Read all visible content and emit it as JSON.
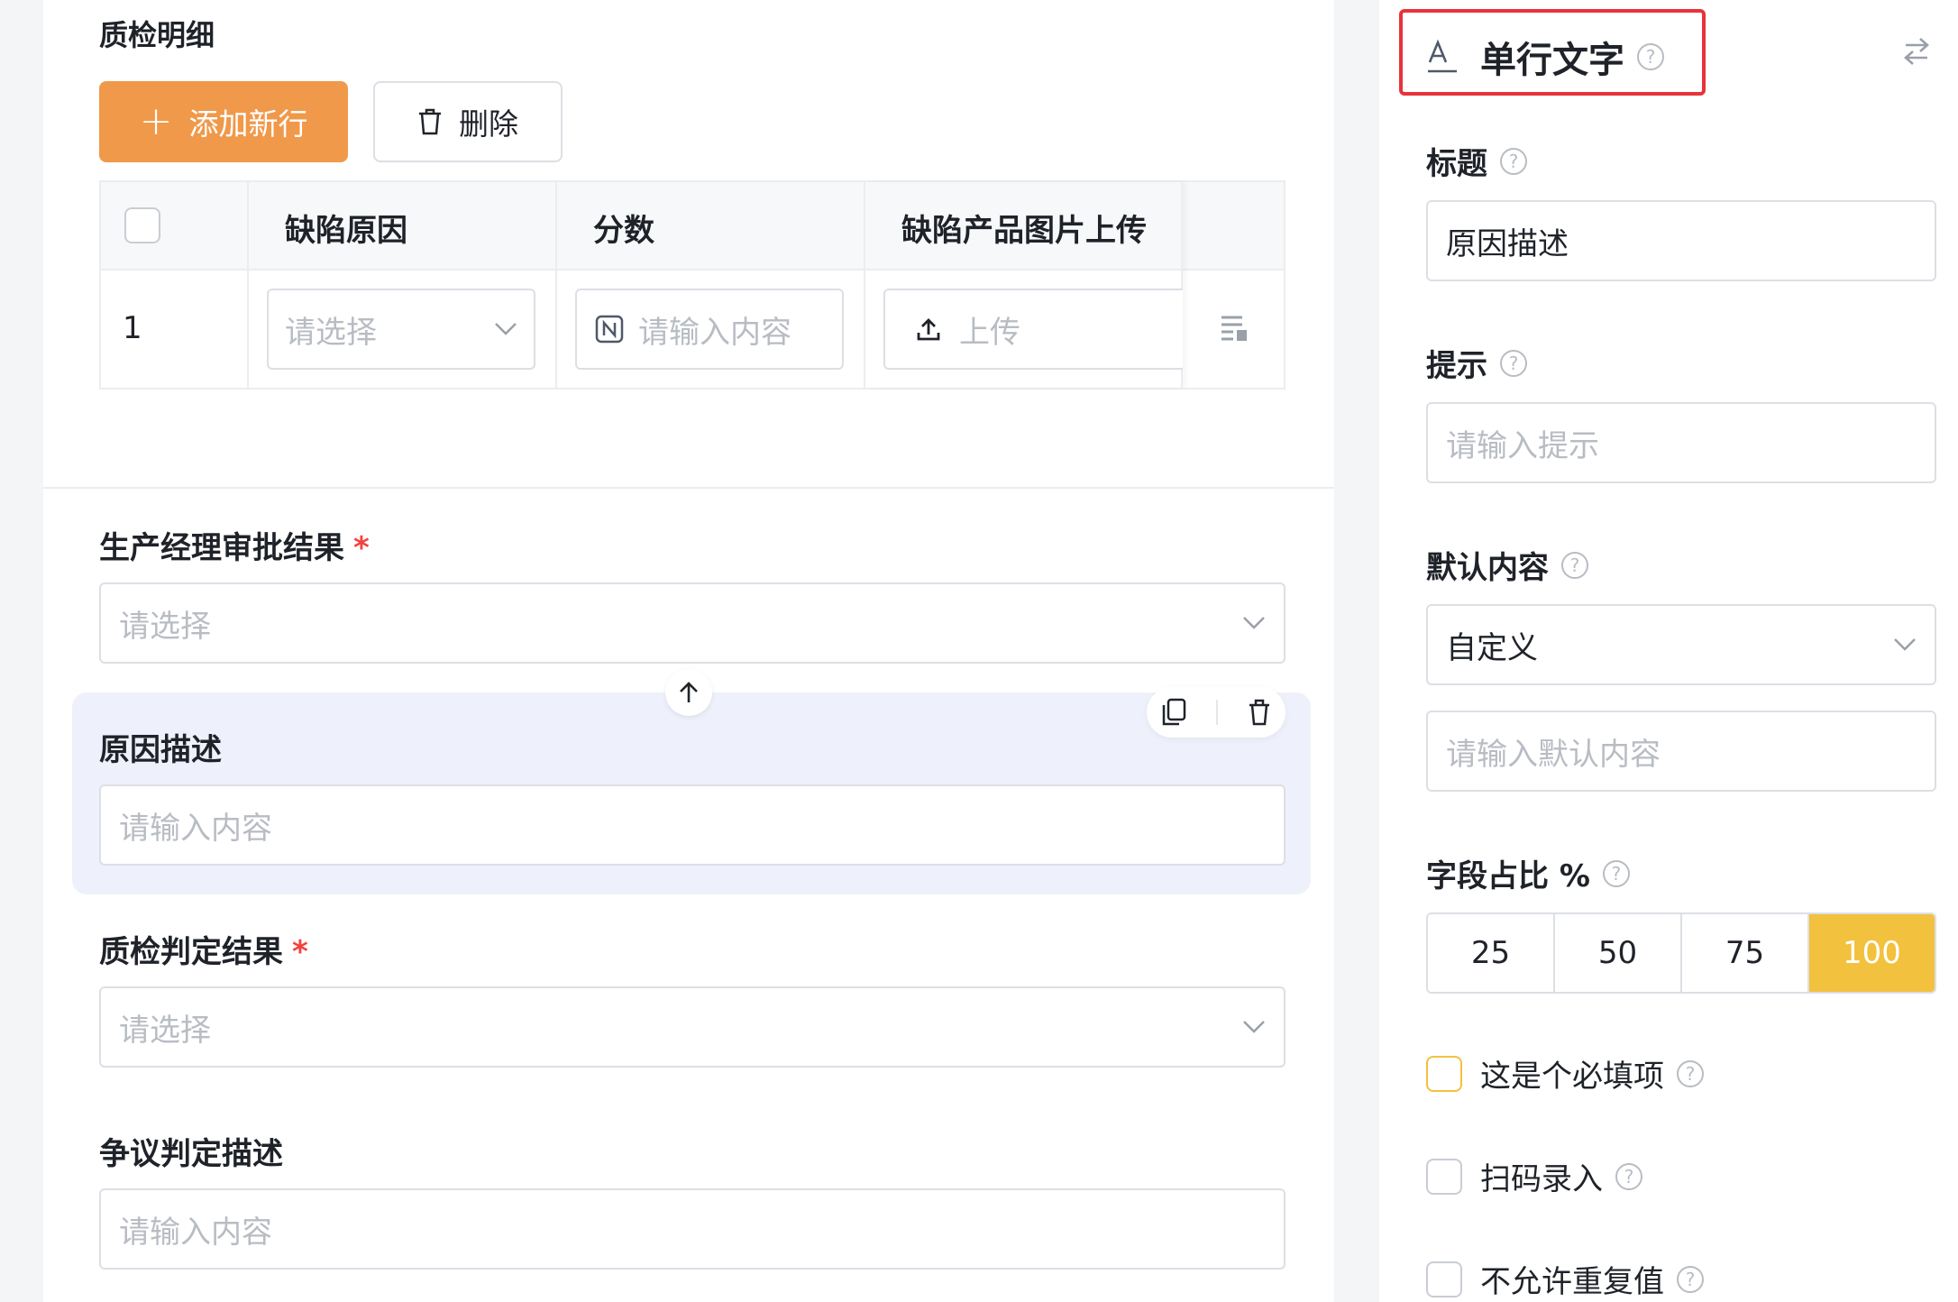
{
  "detail": {
    "title": "质检明细",
    "add_row_label": "添加新行",
    "delete_label": "删除",
    "columns": [
      "缺陷原因",
      "分数",
      "缺陷产品图片上传"
    ],
    "row_index": "1",
    "select_placeholder": "请选择",
    "input_placeholder": "请输入内容",
    "upload_label": "上传"
  },
  "fields": [
    {
      "label": "生产经理审批结果",
      "required": "*",
      "placeholder": "请选择"
    },
    {
      "label": "原因描述",
      "placeholder": "请输入内容"
    },
    {
      "label": "质检判定结果",
      "required": "*",
      "placeholder": "请选择"
    },
    {
      "label": "争议判定描述",
      "placeholder": "请输入内容"
    }
  ],
  "panel": {
    "title": "单行文字",
    "help": "?",
    "title_label": "标题",
    "title_value": "原因描述",
    "hint_label": "提示",
    "hint_placeholder": "请输入提示",
    "default_label": "默认内容",
    "default_mode": "自定义",
    "default_placeholder": "请输入默认内容",
    "ratio_label": "字段占比 %",
    "ratio_options": [
      "25",
      "50",
      "75",
      "100"
    ],
    "ratio_selected": "100",
    "checks": [
      "这是个必填项",
      "扫码录入",
      "不允许重复值"
    ]
  },
  "colors": {
    "primary": "#f0994a",
    "accent": "#f2c13d",
    "required": "#f5413d",
    "highlight": "#e8333c",
    "selected_bg": "#eef1fb"
  }
}
